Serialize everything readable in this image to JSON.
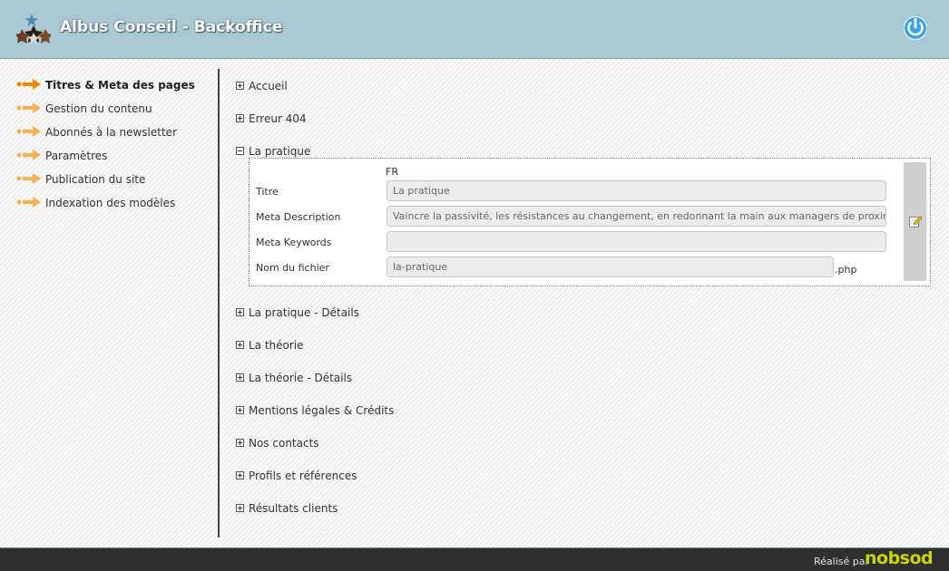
{
  "header": {
    "title": "Albus Conseil - Backoffice",
    "logo_icon": "stars-cluster-logo",
    "power_icon": "power-icon",
    "accent": "#a9c8d4"
  },
  "sidebar": {
    "items": [
      {
        "label": "Titres & Meta des pages",
        "active": true
      },
      {
        "label": "Gestion du contenu",
        "active": false
      },
      {
        "label": "Abonnés à la newsletter",
        "active": false
      },
      {
        "label": "Paramètres",
        "active": false
      },
      {
        "label": "Publication du site",
        "active": false
      },
      {
        "label": "Indexation des modèles",
        "active": false
      }
    ],
    "active_arrow_color": "#f08a00",
    "arrow_color": "#f5b255"
  },
  "tree": {
    "before": [
      "Accueil",
      "Erreur 404"
    ],
    "open": {
      "label": "La pratique",
      "lang": "FR",
      "fields": {
        "title_label": "Titre",
        "title_value": "La pratique",
        "desc_label": "Meta Description",
        "desc_value": "Vaincre la passivité, les résistances au changement, en redonnant la main aux managers de proximité, dans tous les secteurs",
        "keywords_label": "Meta Keywords",
        "keywords_value": "",
        "file_label": "Nom du fichier",
        "file_value": "la-pratique",
        "file_ext": ".php"
      },
      "edit_icon": "pencil-edit-icon"
    },
    "after": [
      "La pratique - Détails",
      "La théorie",
      "La théorie - Détails",
      "Mentions légales & Crédits",
      "Nos contacts",
      "Profils et références",
      "Résultats clients"
    ]
  },
  "footer": {
    "made_by": "Réalisé par",
    "brand": "nobsod",
    "brand_color": "#c9d600"
  }
}
